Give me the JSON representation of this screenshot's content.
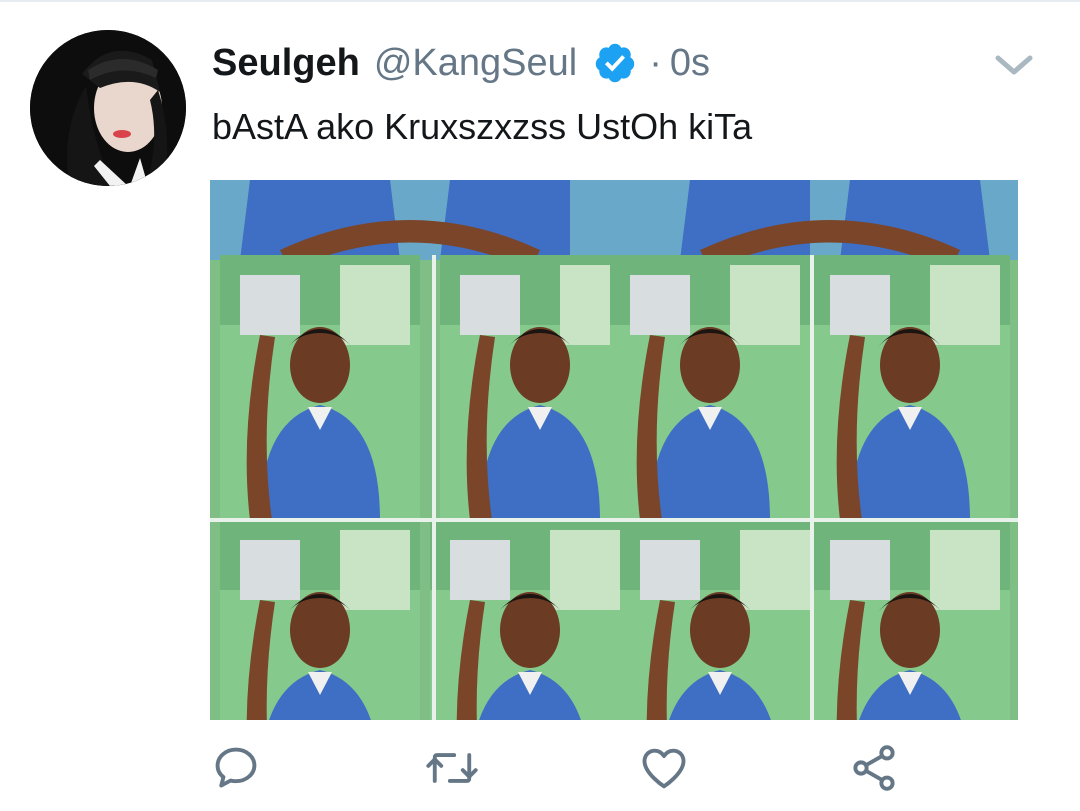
{
  "tweet": {
    "display_name": "Seulgeh",
    "handle": "@KangSeul",
    "separator": "·",
    "timestamp": "0s",
    "text": "bAstA ako Kruxszxzss UstOh kiTa",
    "verified": true,
    "verified_color": "#1da1f2"
  },
  "icons": {
    "verified": "verified-badge-icon",
    "menu": "chevron-down-icon",
    "reply": "reply-icon",
    "retweet": "retweet-icon",
    "like": "heart-icon",
    "share": "share-icon"
  },
  "colors": {
    "text": "#14171a",
    "secondary": "#657786",
    "background": "#ffffff"
  }
}
